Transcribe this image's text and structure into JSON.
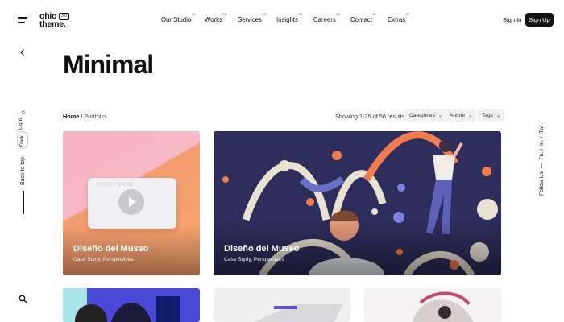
{
  "header": {
    "logo_line1": "ohio",
    "logo_line2": "theme.",
    "logo_version": "3.0",
    "nav": [
      {
        "label": "Our Studio",
        "num": "01"
      },
      {
        "label": "Works",
        "num": "02"
      },
      {
        "label": "Services",
        "num": "03"
      },
      {
        "label": "Insights",
        "num": "04"
      },
      {
        "label": "Careers",
        "num": "05"
      },
      {
        "label": "Contact",
        "num": "06"
      },
      {
        "label": "Extras",
        "num": "07"
      }
    ],
    "sign_in": "Sign In",
    "sign_up": "Sign Up"
  },
  "left_rail": {
    "light": "Light",
    "dark": "Dark",
    "back_to_top": "Back to top"
  },
  "right_rail": {
    "follow": "Follow Us",
    "separator": "—",
    "links": [
      "Fb.",
      "In.",
      "Tw."
    ]
  },
  "page": {
    "title": "Minimal",
    "breadcrumb_home": "Home",
    "breadcrumb_sep": "/",
    "breadcrumb_current": "Portfolio",
    "results": "Showing 1-25 of 56 results",
    "filters": [
      "Categories",
      "Author",
      "Tags"
    ]
  },
  "cards": [
    {
      "title": "Diseño del Museo",
      "subtitle": "Case Stydy, Perspectives",
      "inner_label": "CREDIT CARD"
    },
    {
      "title": "Diseño del Museo",
      "subtitle": "Case Stydy, Perspectives"
    }
  ],
  "colors": {
    "accent": "#111111",
    "card1_pink": "#f5b4c0",
    "card1_orange": "#f39c6e",
    "card2_navy": "#2e2e5c",
    "card3_blue": "#4a48d6"
  }
}
